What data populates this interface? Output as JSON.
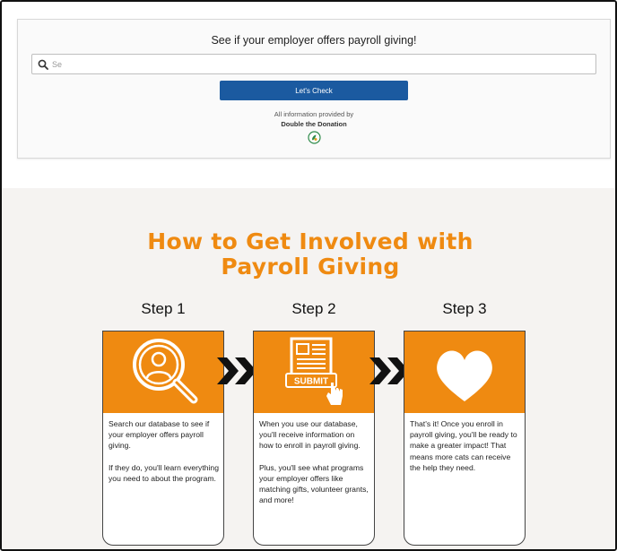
{
  "widget": {
    "title": "See if your employer offers payroll giving!",
    "search_value": "Se",
    "search_placeholder": "Se",
    "button_label": "Let's Check",
    "info_text": "All information provided by",
    "info_brand": "Double the Donation"
  },
  "section": {
    "headline_line1": "How to Get Involved with",
    "headline_line2": "Payroll Giving",
    "steps": [
      {
        "label": "Step 1",
        "icon": "magnifier-person-icon",
        "paragraphs": [
          "Search our database to see if your employer offers payroll giving.",
          "If they do, you'll learn everything you need to about the program."
        ]
      },
      {
        "label": "Step 2",
        "icon": "submit-form-icon",
        "icon_text": "SUBMIT",
        "paragraphs": [
          "When you use our database, you'll receive information on how to enroll in payroll giving.",
          "Plus, you'll see what programs your employer offers like matching gifts, volunteer grants, and more!"
        ]
      },
      {
        "label": "Step 3",
        "icon": "heart-icon",
        "paragraphs": [
          "That's it! Once you enroll in payroll giving, you'll be ready to make a greater impact! That means more cats can receive the help they need."
        ]
      }
    ]
  },
  "colors": {
    "accent_orange": "#ef8a11",
    "button_blue": "#1b5aa0",
    "section_bg": "#f5f3f1"
  }
}
